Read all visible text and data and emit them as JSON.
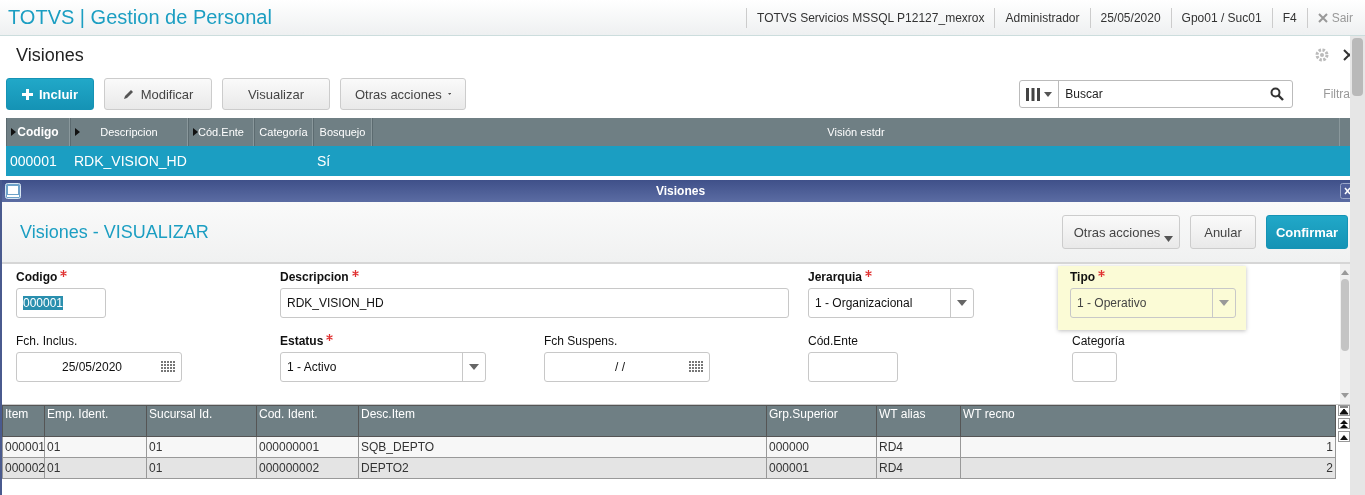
{
  "header": {
    "app_title": "TOTVS | Gestion de Personal",
    "session_items": [
      "TOTVS Servicios MSSQL P12127_mexrox",
      "Administrador",
      "25/05/2020",
      "Gpo01 / Suc01",
      "F4"
    ],
    "logout": {
      "label": "Sair",
      "disabled": true
    }
  },
  "page": {
    "title": "Visiones"
  },
  "toolbar": {
    "buttons": [
      {
        "label": "Incluir",
        "kind": "primary"
      },
      {
        "label": "Modificar",
        "kind": "edit"
      },
      {
        "label": "Visualizar",
        "kind": "plain"
      },
      {
        "label": "Otras acciones",
        "kind": "menu"
      }
    ],
    "search": {
      "placeholder": "Buscar"
    },
    "filter_label": "Filtra"
  },
  "browse": {
    "columns": [
      {
        "label": "Codigo",
        "arrow": true,
        "bold": true
      },
      {
        "label": "Descripcion",
        "arrow": true,
        "bold": false
      },
      {
        "label": "Cód.Ente",
        "arrow": true,
        "bold": false
      },
      {
        "label": "Categoría",
        "arrow": false,
        "bold": false
      },
      {
        "label": "Bosquejo",
        "arrow": false,
        "bold": false
      },
      {
        "label": "Visión estdr",
        "arrow": false,
        "bold": false
      }
    ],
    "rows": [
      {
        "selected": true,
        "cells": [
          "000001",
          "RDK_VISION_HD",
          "",
          "",
          "Sí",
          ""
        ]
      }
    ]
  },
  "dialog": {
    "title": "Visiones",
    "heading": "Visiones - VISUALIZAR",
    "buttons": [
      {
        "label": "Otras acciones",
        "kind": "menu"
      },
      {
        "label": "Anular",
        "kind": "plain"
      },
      {
        "label": "Confirmar",
        "kind": "primary"
      }
    ],
    "fields": [
      {
        "label": "Codigo",
        "required": true,
        "kind": "text",
        "value": "000001",
        "text_selected": true,
        "highlighted": false
      },
      {
        "label": "Descripcion",
        "required": true,
        "kind": "text",
        "value": "RDK_VISION_HD",
        "text_selected": false,
        "highlighted": false
      },
      {
        "label": "Jerarquia",
        "required": true,
        "kind": "select",
        "value": "1 - Organizacional",
        "text_selected": false,
        "highlighted": false
      },
      {
        "label": "Tipo",
        "required": true,
        "kind": "select",
        "value": "1 - Operativo",
        "text_selected": false,
        "highlighted": true
      },
      {
        "label": "Fch. Inclus.",
        "required": false,
        "kind": "date",
        "value": "25/05/2020",
        "text_selected": false,
        "highlighted": false
      },
      {
        "label": "Estatus",
        "required": true,
        "kind": "select",
        "value": "1 - Activo",
        "text_selected": false,
        "highlighted": false
      },
      {
        "label": "Fch Suspens.",
        "required": false,
        "kind": "date",
        "value": "/ /",
        "text_selected": false,
        "highlighted": false
      },
      {
        "label": "Cód.Ente",
        "required": false,
        "kind": "text",
        "highlighted": false
      },
      {
        "label": "Categoría",
        "required": false,
        "kind": "text",
        "highlighted": false
      }
    ],
    "items": {
      "columns": [
        {
          "label": "Item"
        },
        {
          "label": "Emp. Ident."
        },
        {
          "label": "Sucursal Id."
        },
        {
          "label": "Cod. Ident."
        },
        {
          "label": "Desc.Item"
        },
        {
          "label": "Grp.Superior"
        },
        {
          "label": "WT alias"
        },
        {
          "label": "WT recno"
        }
      ],
      "rows": [
        {
          "cells": [
            "000001",
            "01",
            "01",
            "000000001",
            "SQB_DEPTO",
            "000000",
            "RD4",
            "1"
          ]
        },
        {
          "cells": [
            "000002",
            "01",
            "01",
            "000000002",
            "DEPTO2",
            "000001",
            "RD4",
            "2"
          ]
        }
      ]
    }
  }
}
